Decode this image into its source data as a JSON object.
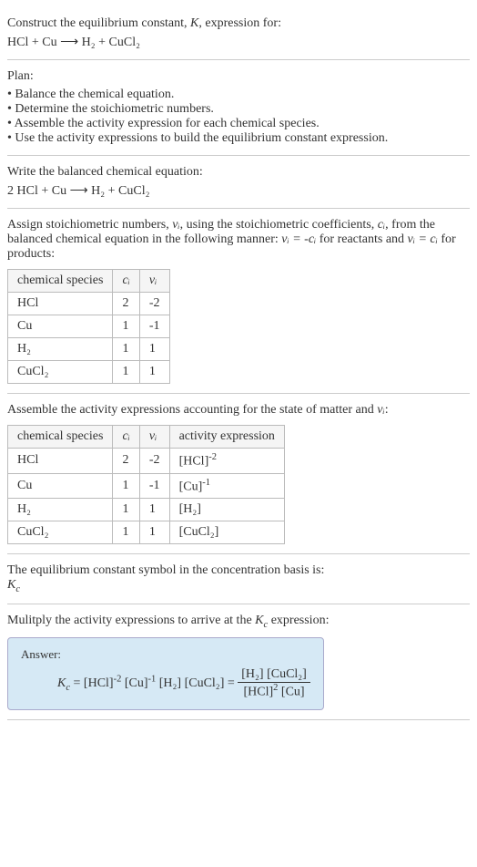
{
  "header": {
    "line1": "Construct the equilibrium constant, ",
    "K": "K",
    "line1b": ", expression for:",
    "equation": "HCl + Cu ⟶ H₂ + CuCl₂"
  },
  "plan": {
    "title": "Plan:",
    "items": [
      "• Balance the chemical equation.",
      "• Determine the stoichiometric numbers.",
      "• Assemble the activity expression for each chemical species.",
      "• Use the activity expressions to build the equilibrium constant expression."
    ]
  },
  "balanced": {
    "title": "Write the balanced chemical equation:",
    "equation": "2 HCl + Cu ⟶ H₂ + CuCl₂"
  },
  "stoich": {
    "desc1": "Assign stoichiometric numbers, ",
    "nu": "νᵢ",
    "desc2": ", using the stoichiometric coefficients, ",
    "ci": "cᵢ",
    "desc3": ", from the balanced chemical equation in the following manner: ",
    "rel1": "νᵢ = -cᵢ",
    "desc4": " for reactants and ",
    "rel2": "νᵢ = cᵢ",
    "desc5": " for products:",
    "table": {
      "headers": [
        "chemical species",
        "cᵢ",
        "νᵢ"
      ],
      "rows": [
        [
          "HCl",
          "2",
          "-2"
        ],
        [
          "Cu",
          "1",
          "-1"
        ],
        [
          "H₂",
          "1",
          "1"
        ],
        [
          "CuCl₂",
          "1",
          "1"
        ]
      ]
    }
  },
  "activity": {
    "desc1": "Assemble the activity expressions accounting for the state of matter and ",
    "nu": "νᵢ",
    "desc2": ":",
    "table": {
      "headers": [
        "chemical species",
        "cᵢ",
        "νᵢ",
        "activity expression"
      ],
      "rows": [
        {
          "species": "HCl",
          "c": "2",
          "v": "-2",
          "expr_base": "[HCl]",
          "expr_sup": "-2"
        },
        {
          "species": "Cu",
          "c": "1",
          "v": "-1",
          "expr_base": "[Cu]",
          "expr_sup": "-1"
        },
        {
          "species": "H₂",
          "c": "1",
          "v": "1",
          "expr_base": "[H₂]",
          "expr_sup": ""
        },
        {
          "species": "CuCl₂",
          "c": "1",
          "v": "1",
          "expr_base": "[CuCl₂]",
          "expr_sup": ""
        }
      ]
    }
  },
  "symbol": {
    "line1": "The equilibrium constant symbol in the concentration basis is:",
    "kc": "K",
    "kc_sub": "c"
  },
  "multiply": {
    "line1": "Mulitply the activity expressions to arrive at the ",
    "kc": "K",
    "kc_sub": "c",
    "line2": " expression:"
  },
  "answer": {
    "title": "Answer:",
    "kc": "K",
    "kc_sub": "c",
    "eq": " = ",
    "term1_base": "[HCl]",
    "term1_sup": "-2",
    "term2_base": " [Cu]",
    "term2_sup": "-1",
    "term3": " [H₂] [CuCl₂] = ",
    "frac_num": "[H₂] [CuCl₂]",
    "frac_den_1": "[HCl]",
    "frac_den_1_sup": "2",
    "frac_den_2": " [Cu]"
  }
}
